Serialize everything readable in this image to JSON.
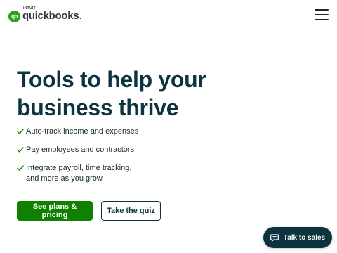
{
  "header": {
    "logo_mark": "qb",
    "logo_intuit": "INTUIT",
    "logo_name": "quickbooks",
    "logo_dot": ".",
    "menu_icon": "hamburger-menu-icon"
  },
  "hero": {
    "headline": "Tools to help your business thrive",
    "features": [
      "Auto-track income and expenses",
      "Pay employees and contractors",
      "Integrate payroll, time tracking, and more as you grow"
    ],
    "primary_cta": "See plans & pricing",
    "secondary_cta": "Take the quiz"
  },
  "chat": {
    "label": "Talk to sales",
    "icon": "chat-bubble-icon"
  },
  "colors": {
    "brand_green": "#2ca01c",
    "cta_green": "#108000",
    "check_green": "#108000",
    "navy": "#0d333f"
  }
}
